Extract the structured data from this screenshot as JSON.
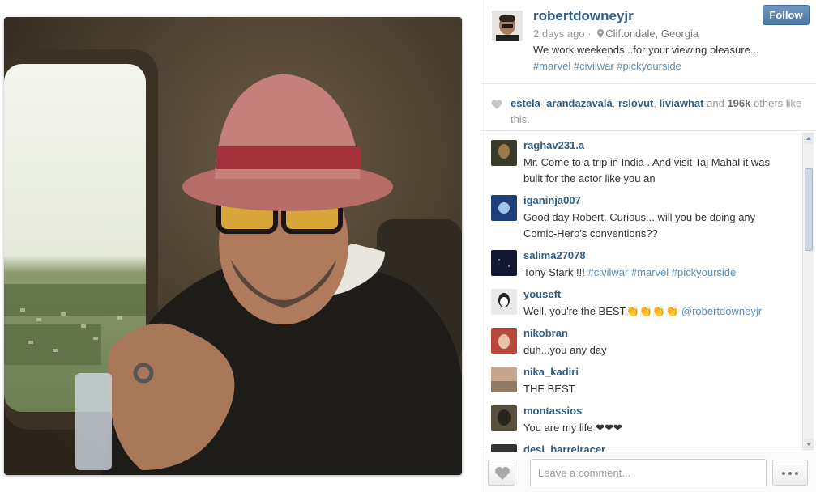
{
  "post": {
    "username": "robertdowneyjr",
    "time": "2 days ago",
    "location": "Cliftondale, Georgia",
    "caption": "We work weekends ..for your viewing pleasure...",
    "hashtags": "#marvel #civilwar #pickyourside",
    "follow_label": "Follow"
  },
  "likes": {
    "users": [
      "estela_arandazavala",
      "rslovut",
      "liviawhat"
    ],
    "and": "and",
    "count": "196k",
    "suffix": "others like this."
  },
  "comments": [
    {
      "user": "raghav231.a",
      "text": "Mr. Come to a trip in India . And visit Taj Mahal it was bulit for the actor like you an",
      "tags": "",
      "avatar_color": "#3a3a2a"
    },
    {
      "user": "iganinja007",
      "text": "Good day Robert. Curious... will you be doing any Comic-Hero's conventions??",
      "tags": "",
      "avatar_color": "#1c3e7a"
    },
    {
      "user": "salima27078",
      "text": "Tony Stark !!! ",
      "tags": "#civilwar #marvel #pickyourside",
      "avatar_color": "#121833"
    },
    {
      "user": "youseft_",
      "text": "Well, you're the BEST👏👏👏👏 ",
      "tags": "@robertdowneyjr",
      "avatar_color": "#e9e9e9"
    },
    {
      "user": "nikobran",
      "text": "duh...you any day",
      "tags": "",
      "avatar_color": "#b8483c"
    },
    {
      "user": "nika_kadiri",
      "text": "THE BEST",
      "tags": "",
      "avatar_color": "#c7a58d"
    },
    {
      "user": "montassios",
      "text": "You are my life ❤❤❤",
      "tags": "",
      "avatar_color": "#5a5040"
    },
    {
      "user": "desi_barrelracer",
      "text": "",
      "tags": "",
      "avatar_color": "#333333"
    }
  ],
  "footer": {
    "comment_placeholder": "Leave a comment..."
  },
  "colors": {
    "link_blue": "#2e5e86",
    "tag_blue": "#5e8eb7",
    "follow_button": "#4d7aa8"
  },
  "icons": [
    "location-pin-icon",
    "heart-icon",
    "ellipsis-icon",
    "scroll-up-arrow-icon",
    "scroll-down-arrow-icon"
  ]
}
